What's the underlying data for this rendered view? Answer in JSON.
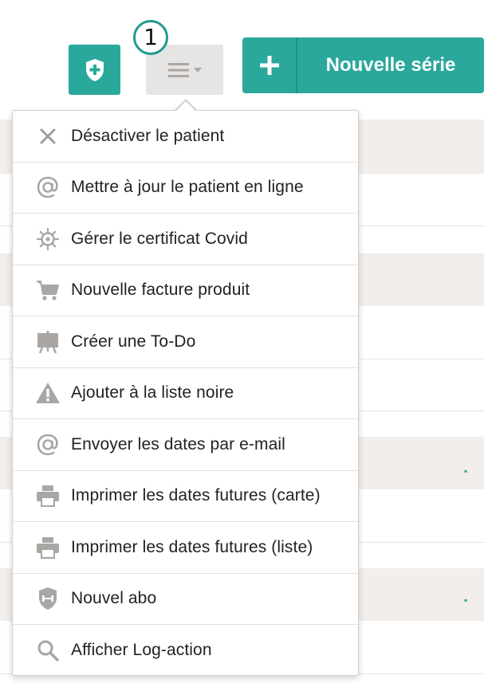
{
  "badge": {
    "number": "1"
  },
  "toolbar": {
    "shield_icon": "shield-plus-icon",
    "menu_icon": "hamburger-menu-icon",
    "new_series_label": "Nouvelle série",
    "accent_color": "#2aa89b"
  },
  "menu": {
    "items": [
      {
        "label": "Désactiver le patient",
        "icon": "close-icon"
      },
      {
        "label": "Mettre à jour le patient en ligne",
        "icon": "at-sign-icon"
      },
      {
        "label": "Gérer le certificat Covid",
        "icon": "virus-icon"
      },
      {
        "label": "Nouvelle facture produit",
        "icon": "shopping-cart-icon"
      },
      {
        "label": "Créer une To-Do",
        "icon": "easel-board-icon"
      },
      {
        "label": "Ajouter à la liste noire",
        "icon": "warning-triangle-icon"
      },
      {
        "label": "Envoyer les dates par e-mail",
        "icon": "at-sign-icon"
      },
      {
        "label": "Imprimer les dates futures (carte)",
        "icon": "printer-icon"
      },
      {
        "label": "Imprimer les dates futures (liste)",
        "icon": "printer-icon"
      },
      {
        "label": "Nouvel abo",
        "icon": "shield-dumbbell-icon"
      },
      {
        "label": "Afficher Log-action",
        "icon": "search-icon"
      }
    ]
  }
}
